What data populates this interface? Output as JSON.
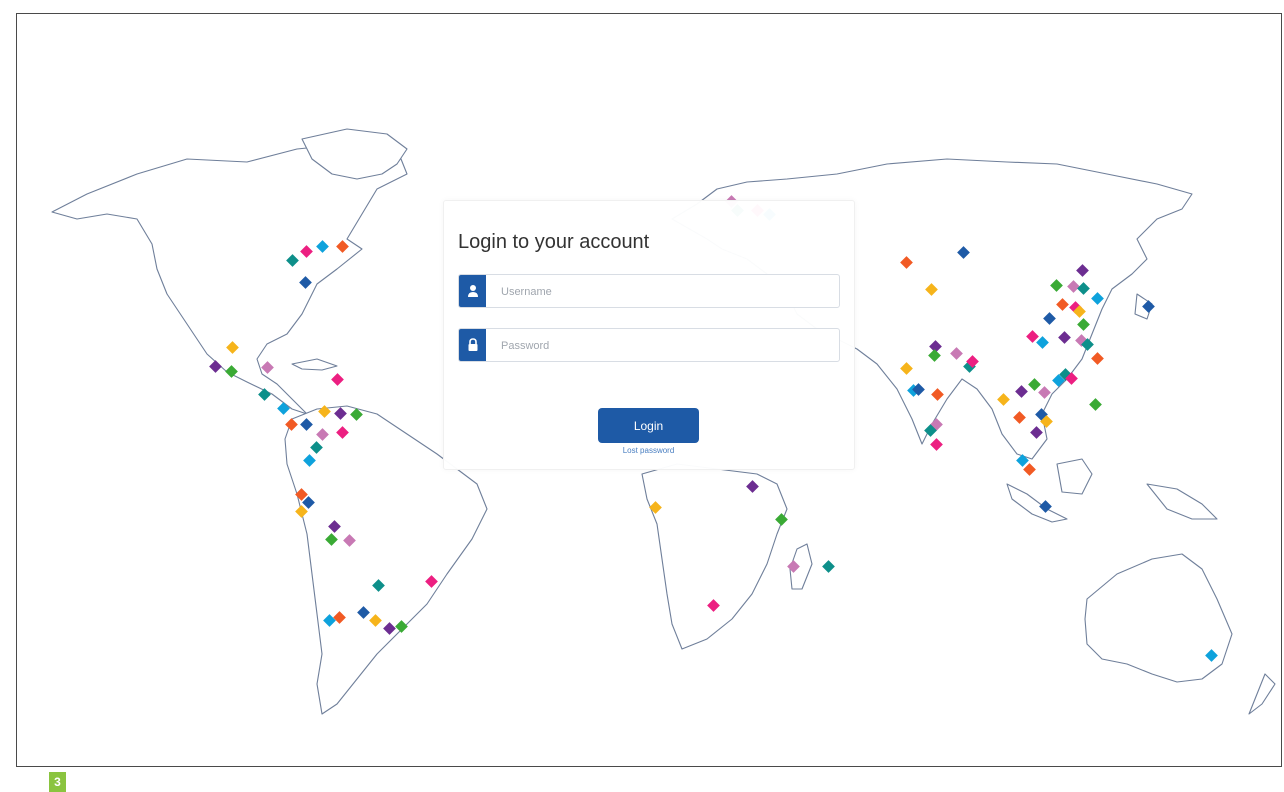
{
  "login": {
    "title": "Login to your account",
    "username_placeholder": "Username",
    "password_placeholder": "Password",
    "login_button": "Login",
    "lost_password_link": "Lost password"
  },
  "figure_number": "3",
  "colors": {
    "accent": "#1e5aa6",
    "badge": "#8ac43f",
    "marker_palette": [
      "#6c2d91",
      "#1e5aa6",
      "#0ea2dc",
      "#0d8f8a",
      "#3aaa35",
      "#f6b41b",
      "#f15a24",
      "#ec1f81",
      "#c879b4"
    ]
  },
  "icons": {
    "username": "user-icon",
    "password": "lock-icon"
  }
}
